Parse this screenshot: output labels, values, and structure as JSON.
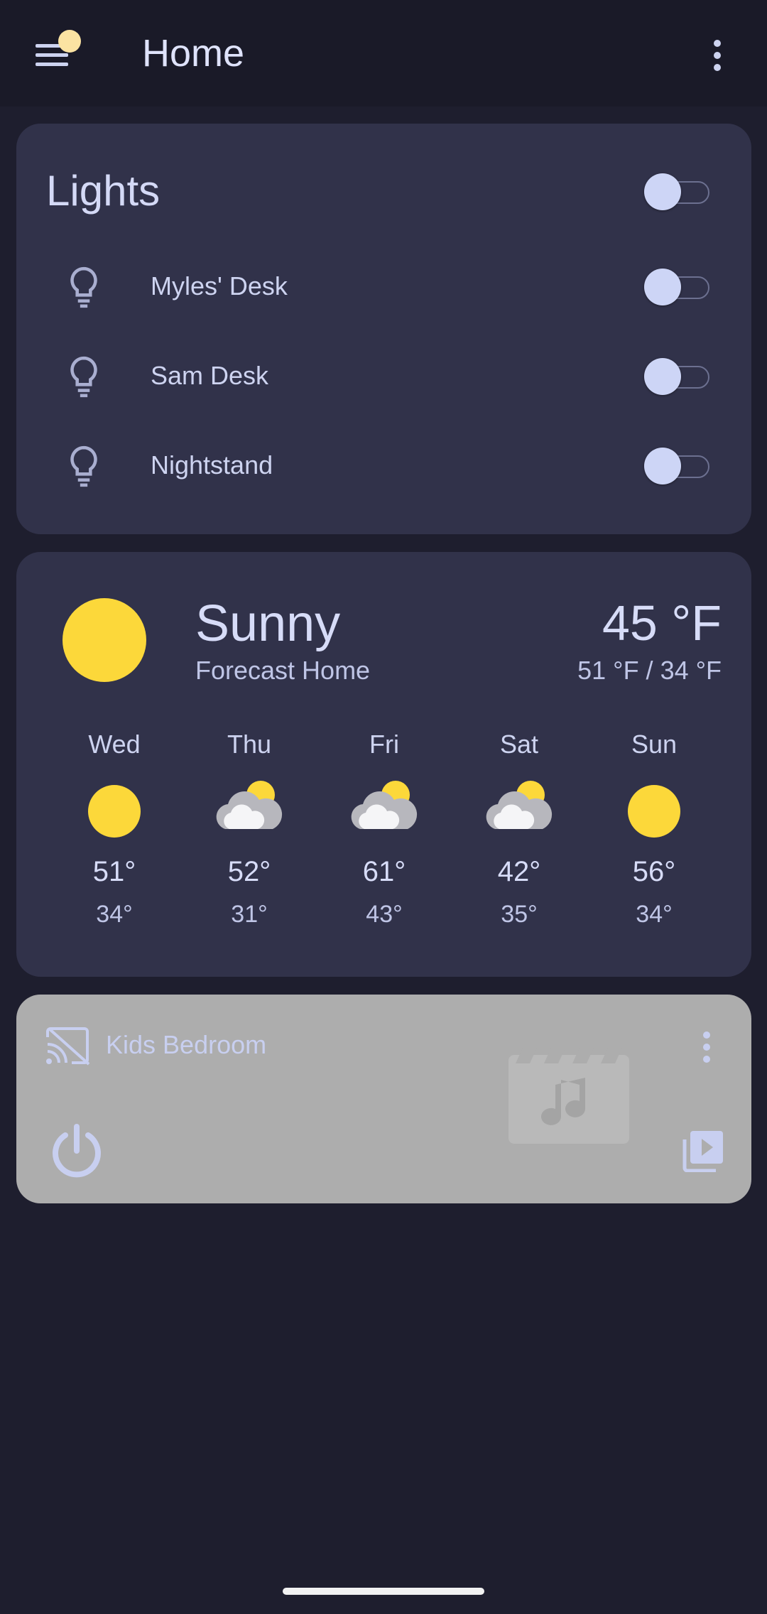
{
  "app_bar": {
    "title": "Home"
  },
  "lights": {
    "title": "Lights",
    "group_on": false,
    "items": [
      {
        "label": "Myles' Desk",
        "on": false
      },
      {
        "label": "Sam Desk",
        "on": false
      },
      {
        "label": "Nightstand",
        "on": false
      }
    ]
  },
  "weather": {
    "condition": "Sunny",
    "location": "Forecast Home",
    "temperature": "45 °F",
    "high_low": "51 °F / 34 °F",
    "forecast": [
      {
        "day": "Wed",
        "icon": "sunny",
        "high": "51°",
        "low": "34°"
      },
      {
        "day": "Thu",
        "icon": "partly-cloudy",
        "high": "52°",
        "low": "31°"
      },
      {
        "day": "Fri",
        "icon": "partly-cloudy",
        "high": "61°",
        "low": "43°"
      },
      {
        "day": "Sat",
        "icon": "partly-cloudy",
        "high": "42°",
        "low": "35°"
      },
      {
        "day": "Sun",
        "icon": "sunny",
        "high": "56°",
        "low": "34°"
      }
    ]
  },
  "media": {
    "name": "Kids Bedroom",
    "state": "off"
  },
  "colors": {
    "background": "#1e1e2e",
    "card": "#31324a",
    "media_card": "#adadad",
    "sun": "#fcd83a",
    "accent": "#cdd5f6"
  }
}
